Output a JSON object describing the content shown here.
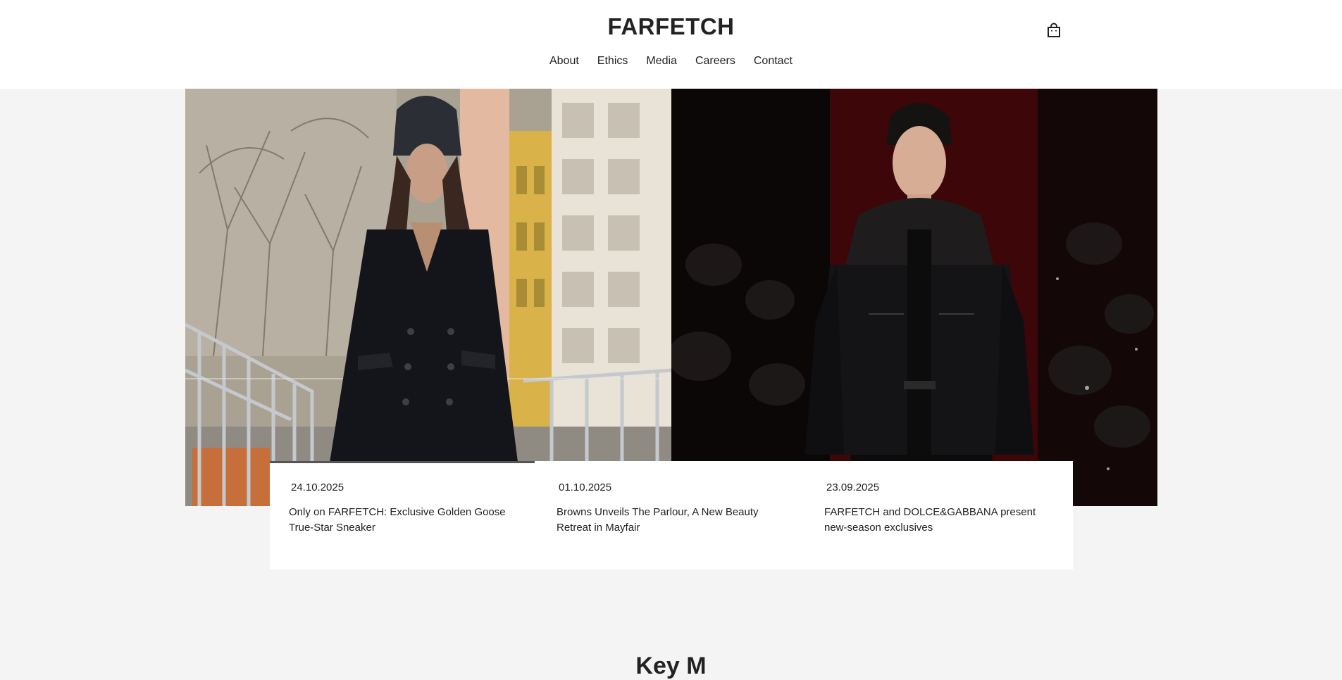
{
  "header": {
    "logo": "FARFETCH",
    "nav": [
      "About",
      "Ethics",
      "Media",
      "Careers",
      "Contact"
    ],
    "bag_icon": "shopping-bag-icon"
  },
  "hero": {
    "images": [
      "woman in black double-breasted coat and beanie on city street",
      "man in black leather jacket with fur collar on runway"
    ]
  },
  "news": {
    "progress": 0.33,
    "items": [
      {
        "date": "24.10.2025",
        "title": "Only on FARFETCH: Exclusive Golden Goose True-Star Sneaker"
      },
      {
        "date": "01.10.2025",
        "title": "Browns Unveils The Parlour, A New Beauty Retreat in Mayfair"
      },
      {
        "date": "23.09.2025",
        "title": "FARFETCH and DOLCE&GABBANA present new-season exclusives"
      }
    ]
  },
  "colors": {
    "background": "#f4f4f4",
    "header_bg": "#ffffff",
    "text": "#222222"
  },
  "next_section": {
    "title": "Key M"
  }
}
